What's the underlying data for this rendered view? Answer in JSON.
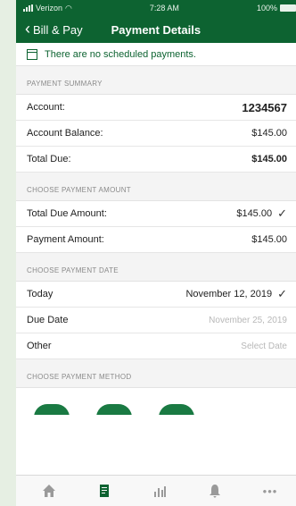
{
  "status": {
    "carrier": "Verizon",
    "time": "7:28 AM",
    "battery": "100%"
  },
  "nav": {
    "back_label": "Bill & Pay",
    "title": "Payment Details"
  },
  "notice": {
    "text": "There are no scheduled payments."
  },
  "summary": {
    "header": "PAYMENT SUMMARY",
    "rows": [
      {
        "label": "Account:",
        "value": "1234567"
      },
      {
        "label": "Account Balance:",
        "value": "$145.00"
      },
      {
        "label": "Total Due:",
        "value": "$145.00"
      }
    ]
  },
  "amount": {
    "header": "CHOOSE PAYMENT AMOUNT",
    "rows": [
      {
        "label": "Total Due Amount:",
        "value": "$145.00",
        "check": "✓"
      },
      {
        "label": "Payment Amount:",
        "value": "$145.00"
      }
    ]
  },
  "date": {
    "header": "CHOOSE PAYMENT DATE",
    "rows": [
      {
        "label": "Today",
        "value": "November 12, 2019",
        "check": "✓"
      },
      {
        "label": "Due Date",
        "value": "November 25, 2019"
      },
      {
        "label": "Other",
        "value": "Select Date"
      }
    ]
  },
  "method": {
    "header": "CHOOSE PAYMENT METHOD"
  },
  "tabs": {
    "icons": [
      "home-icon",
      "bill-icon",
      "usage-icon",
      "notifications-icon",
      "more-icon"
    ],
    "more_glyph": "•••",
    "active_color": "#0d6331"
  },
  "colors": {
    "brand_green": "#0d6331",
    "background": "#e6efe3"
  }
}
